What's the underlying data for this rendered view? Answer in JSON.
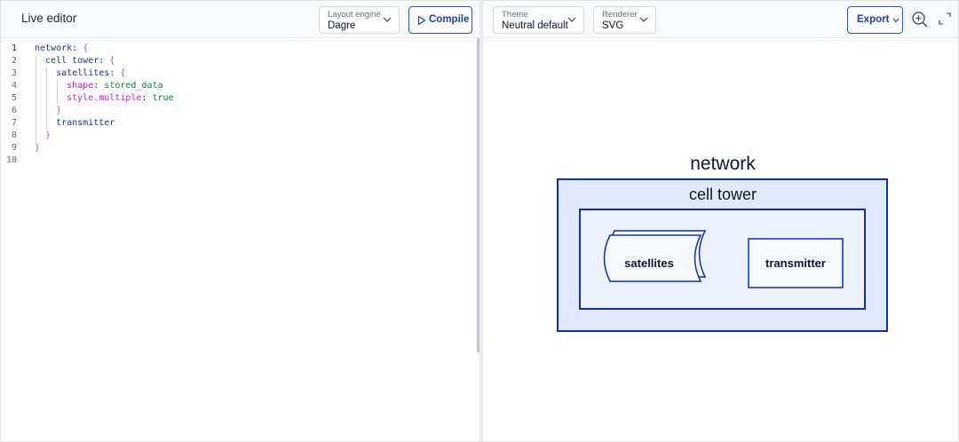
{
  "editor_pane": {
    "title": "Live editor",
    "layout_engine": {
      "label": "Layout engine",
      "value": "Dagre"
    },
    "compile_button": {
      "label": "Compile",
      "icon": "play-outline-icon"
    },
    "code_lines": [
      {
        "num": "1",
        "tokens": [
          {
            "t": "network",
            "c": "k"
          },
          {
            "t": ": ",
            "c": "k"
          },
          {
            "t": "{",
            "c": "p"
          }
        ]
      },
      {
        "num": "2",
        "tokens": [
          {
            "t": "  cell tower",
            "c": "k"
          },
          {
            "t": ": ",
            "c": "k"
          },
          {
            "t": "{",
            "c": "p"
          }
        ]
      },
      {
        "num": "3",
        "tokens": [
          {
            "t": "    satellites",
            "c": "k"
          },
          {
            "t": ": ",
            "c": "k"
          },
          {
            "t": "{",
            "c": "p"
          }
        ]
      },
      {
        "num": "4",
        "tokens": [
          {
            "t": "      shape",
            "c": "pk"
          },
          {
            "t": ": ",
            "c": "k"
          },
          {
            "t": "stored_data",
            "c": "v"
          }
        ]
      },
      {
        "num": "5",
        "tokens": [
          {
            "t": "      style.multiple",
            "c": "pk"
          },
          {
            "t": ": ",
            "c": "k"
          },
          {
            "t": "true",
            "c": "v"
          }
        ]
      },
      {
        "num": "6",
        "tokens": [
          {
            "t": "    }",
            "c": "p"
          }
        ]
      },
      {
        "num": "7",
        "tokens": [
          {
            "t": "    transmitter",
            "c": "k"
          }
        ]
      },
      {
        "num": "8",
        "tokens": [
          {
            "t": "  }",
            "c": "p"
          }
        ]
      },
      {
        "num": "9",
        "tokens": [
          {
            "t": "}",
            "c": "p"
          }
        ]
      },
      {
        "num": "10",
        "tokens": []
      }
    ]
  },
  "preview_pane": {
    "theme": {
      "label": "Theme",
      "value": "Neutral default"
    },
    "renderer": {
      "label": "Renderer",
      "value": "SVG"
    },
    "export_button": {
      "label": "Export",
      "icon": "chevron-down-icon"
    },
    "zoom_icon": "zoom-in-icon",
    "fullscreen_icon": "fullscreen-icon"
  },
  "diagram": {
    "outer_label": "network",
    "inner_label": "cell tower",
    "nodes": [
      {
        "id": "satellites",
        "label": "satellites",
        "shape": "stored_data",
        "multiple": true
      },
      {
        "id": "transmitter",
        "label": "transmitter",
        "shape": "rectangle"
      }
    ]
  },
  "colors": {
    "accent": "#1e40af",
    "diagram_stroke": "#0d32b2",
    "outer_fill": "#e3e9fd",
    "inner_fill": "#edf0fd",
    "node_fill": "#f7f8fe",
    "keyword": "#1e3a8a",
    "punctuation": "#a855f7",
    "property": "#c026d3",
    "value": "#15803d"
  }
}
